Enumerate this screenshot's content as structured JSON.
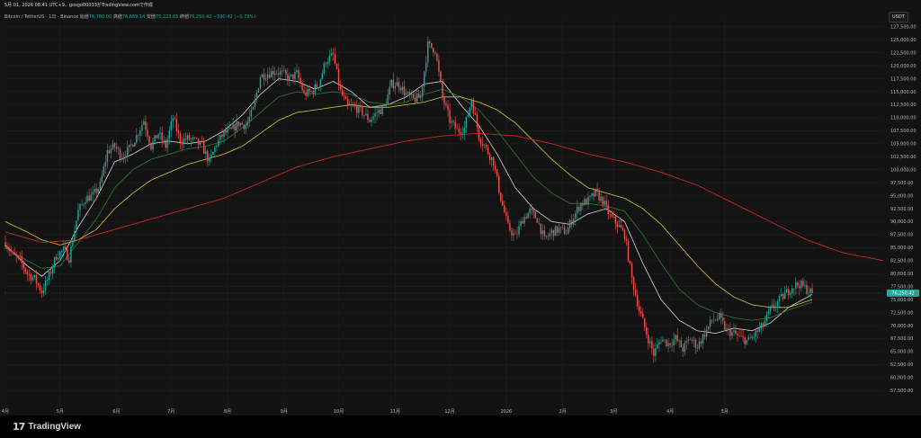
{
  "header": {
    "text": "5月 01, 2026 08:41 UTC+9、gosgo00033がTradingView.comで作成"
  },
  "legend": {
    "symbol": "Bitcoin / TetherUS · 1日 · Binance",
    "open_label": "始値",
    "open": "76,780.00",
    "high_label": "高値",
    "high": "76,669.14",
    "low_label": "安値",
    "low": "75,223.65",
    "close_label": "終値",
    "close": "76,250.42",
    "change": "−590.42 (−0.73%)"
  },
  "currency": "USDT",
  "brand": "TradingView",
  "colors": {
    "background": "#131313",
    "up": "#26a69a",
    "down": "#ef5350",
    "ema_white": "#d7d7d7",
    "ema_green": "#2e7d32",
    "ema_yellow": "#d4c93c",
    "ema_red": "#c62828"
  },
  "chart_data": {
    "type": "candlestick",
    "ylim": [
      56500,
      128500
    ],
    "y_ticks": [
      "127,500.00",
      "125,000.00",
      "122,500.00",
      "120,000.00",
      "117,500.00",
      "115,000.00",
      "112,500.00",
      "110,000.00",
      "107,500.00",
      "105,000.00",
      "102,500.00",
      "100,000.00",
      "97,500.00",
      "95,000.00",
      "92,500.00",
      "90,000.00",
      "87,500.00",
      "85,000.00",
      "82,500.00",
      "80,000.00",
      "77,500.00",
      "75,000.00",
      "72,500.00",
      "70,000.00",
      "67,500.00",
      "65,000.00",
      "62,500.00",
      "60,000.00",
      "57,500.00"
    ],
    "x_ticks": [
      "4月",
      "5月",
      "6月",
      "7月",
      "8月",
      "9月",
      "10月",
      "11月",
      "12月",
      "2026",
      "2月",
      "3月",
      "4月",
      "5月"
    ],
    "current_price": 76250.42,
    "current_price_label": "76,250.42",
    "date_start": "2025-04-01",
    "date_end": "2026-05-01",
    "close_path": [
      [
        0,
        86000
      ],
      [
        4,
        83500
      ],
      [
        8,
        82500
      ],
      [
        12,
        80000
      ],
      [
        16,
        79000
      ],
      [
        20,
        76500
      ],
      [
        24,
        79500
      ],
      [
        28,
        83500
      ],
      [
        32,
        84500
      ],
      [
        35,
        83000
      ],
      [
        40,
        92000
      ],
      [
        44,
        94500
      ],
      [
        48,
        95000
      ],
      [
        52,
        97000
      ],
      [
        56,
        103500
      ],
      [
        60,
        104500
      ],
      [
        64,
        102500
      ],
      [
        68,
        104000
      ],
      [
        72,
        106500
      ],
      [
        76,
        109500
      ],
      [
        80,
        104500
      ],
      [
        84,
        107000
      ],
      [
        88,
        104500
      ],
      [
        92,
        110000
      ],
      [
        96,
        105500
      ],
      [
        100,
        106000
      ],
      [
        104,
        105500
      ],
      [
        108,
        104500
      ],
      [
        112,
        101500
      ],
      [
        116,
        105000
      ],
      [
        120,
        107000
      ],
      [
        124,
        107500
      ],
      [
        128,
        109000
      ],
      [
        132,
        108500
      ],
      [
        136,
        111500
      ],
      [
        140,
        118000
      ],
      [
        144,
        118500
      ],
      [
        148,
        119000
      ],
      [
        152,
        118500
      ],
      [
        156,
        117500
      ],
      [
        160,
        118500
      ],
      [
        164,
        114500
      ],
      [
        168,
        115000
      ],
      [
        172,
        116500
      ],
      [
        176,
        121000
      ],
      [
        180,
        122000
      ],
      [
        184,
        115000
      ],
      [
        188,
        112000
      ],
      [
        192,
        112000
      ],
      [
        196,
        111000
      ],
      [
        200,
        109500
      ],
      [
        204,
        111000
      ],
      [
        208,
        112000
      ],
      [
        212,
        116500
      ],
      [
        216,
        116500
      ],
      [
        220,
        114500
      ],
      [
        224,
        113500
      ],
      [
        228,
        114000
      ],
      [
        232,
        124000
      ],
      [
        236,
        123000
      ],
      [
        240,
        114000
      ],
      [
        244,
        109500
      ],
      [
        248,
        107500
      ],
      [
        252,
        108000
      ],
      [
        256,
        113500
      ],
      [
        260,
        106500
      ],
      [
        264,
        104000
      ],
      [
        268,
        101500
      ],
      [
        272,
        94500
      ],
      [
        276,
        89000
      ],
      [
        280,
        87000
      ],
      [
        284,
        90500
      ],
      [
        288,
        92000
      ],
      [
        292,
        90500
      ],
      [
        296,
        86500
      ],
      [
        300,
        88000
      ],
      [
        304,
        88500
      ],
      [
        308,
        88000
      ],
      [
        312,
        91000
      ],
      [
        316,
        93500
      ],
      [
        320,
        94000
      ],
      [
        324,
        95500
      ],
      [
        328,
        94000
      ],
      [
        332,
        91000
      ],
      [
        336,
        89500
      ],
      [
        340,
        87500
      ],
      [
        344,
        79000
      ],
      [
        348,
        73000
      ],
      [
        352,
        68500
      ],
      [
        356,
        64500
      ],
      [
        360,
        67500
      ],
      [
        364,
        66500
      ],
      [
        368,
        67500
      ],
      [
        372,
        65500
      ],
      [
        376,
        67500
      ],
      [
        380,
        66000
      ],
      [
        384,
        68500
      ],
      [
        388,
        71000
      ],
      [
        392,
        71500
      ],
      [
        396,
        69000
      ],
      [
        400,
        68500
      ],
      [
        404,
        67500
      ],
      [
        408,
        67000
      ],
      [
        412,
        68500
      ],
      [
        416,
        70000
      ],
      [
        420,
        73000
      ],
      [
        424,
        74500
      ],
      [
        428,
        76000
      ],
      [
        432,
        77500
      ],
      [
        436,
        78000
      ],
      [
        440,
        77000
      ],
      [
        443,
        76250
      ]
    ],
    "series": [
      {
        "points": [
          [
            0,
            85500
          ],
          [
            12,
            81500
          ],
          [
            20,
            79500
          ],
          [
            30,
            82500
          ],
          [
            40,
            89000
          ],
          [
            50,
            94500
          ],
          [
            60,
            101500
          ],
          [
            70,
            103000
          ],
          [
            80,
            105000
          ],
          [
            90,
            105500
          ],
          [
            100,
            105000
          ],
          [
            110,
            105500
          ],
          [
            120,
            107500
          ],
          [
            130,
            110500
          ],
          [
            140,
            114500
          ],
          [
            150,
            117500
          ],
          [
            160,
            117000
          ],
          [
            170,
            115500
          ],
          [
            180,
            117000
          ],
          [
            190,
            115000
          ],
          [
            200,
            112000
          ],
          [
            210,
            112500
          ],
          [
            220,
            114000
          ],
          [
            230,
            116500
          ],
          [
            240,
            117000
          ],
          [
            250,
            112500
          ],
          [
            260,
            108500
          ],
          [
            270,
            103000
          ],
          [
            280,
            96500
          ],
          [
            290,
            92500
          ],
          [
            300,
            90000
          ],
          [
            310,
            89500
          ],
          [
            320,
            91500
          ],
          [
            330,
            92500
          ],
          [
            340,
            90000
          ],
          [
            350,
            82000
          ],
          [
            360,
            75000
          ],
          [
            370,
            71000
          ],
          [
            380,
            69000
          ],
          [
            390,
            68500
          ],
          [
            400,
            69500
          ],
          [
            410,
            69000
          ],
          [
            420,
            70500
          ],
          [
            430,
            73500
          ],
          [
            443,
            76000
          ]
        ]
      },
      {
        "points": [
          [
            0,
            85000
          ],
          [
            12,
            82500
          ],
          [
            20,
            81000
          ],
          [
            30,
            81500
          ],
          [
            40,
            86000
          ],
          [
            50,
            90500
          ],
          [
            60,
            96500
          ],
          [
            70,
            100000
          ],
          [
            80,
            102000
          ],
          [
            90,
            103000
          ],
          [
            100,
            104000
          ],
          [
            110,
            104500
          ],
          [
            120,
            105500
          ],
          [
            130,
            108000
          ],
          [
            140,
            111000
          ],
          [
            150,
            114000
          ],
          [
            160,
            115000
          ],
          [
            170,
            114500
          ],
          [
            180,
            115000
          ],
          [
            190,
            114500
          ],
          [
            200,
            113000
          ],
          [
            210,
            112500
          ],
          [
            220,
            113000
          ],
          [
            230,
            114500
          ],
          [
            240,
            115500
          ],
          [
            250,
            114000
          ],
          [
            260,
            111500
          ],
          [
            270,
            107500
          ],
          [
            280,
            103000
          ],
          [
            290,
            98500
          ],
          [
            300,
            95500
          ],
          [
            310,
            93500
          ],
          [
            320,
            93500
          ],
          [
            330,
            93000
          ],
          [
            340,
            92000
          ],
          [
            350,
            87500
          ],
          [
            360,
            82000
          ],
          [
            370,
            77000
          ],
          [
            380,
            74000
          ],
          [
            390,
            72500
          ],
          [
            400,
            71500
          ],
          [
            410,
            71000
          ],
          [
            420,
            71500
          ],
          [
            430,
            73000
          ],
          [
            443,
            74500
          ]
        ]
      },
      {
        "points": [
          [
            0,
            90000
          ],
          [
            12,
            88000
          ],
          [
            20,
            86500
          ],
          [
            30,
            85500
          ],
          [
            40,
            86500
          ],
          [
            50,
            88500
          ],
          [
            60,
            92500
          ],
          [
            70,
            95500
          ],
          [
            80,
            98000
          ],
          [
            90,
            99500
          ],
          [
            100,
            101000
          ],
          [
            110,
            102000
          ],
          [
            120,
            103000
          ],
          [
            130,
            104500
          ],
          [
            140,
            107000
          ],
          [
            150,
            109500
          ],
          [
            160,
            111000
          ],
          [
            170,
            111500
          ],
          [
            180,
            112000
          ],
          [
            190,
            112500
          ],
          [
            200,
            112000
          ],
          [
            210,
            112000
          ],
          [
            220,
            112500
          ],
          [
            230,
            113000
          ],
          [
            240,
            114000
          ],
          [
            250,
            114000
          ],
          [
            260,
            113000
          ],
          [
            270,
            111500
          ],
          [
            280,
            109000
          ],
          [
            290,
            105500
          ],
          [
            300,
            102000
          ],
          [
            310,
            99000
          ],
          [
            320,
            96500
          ],
          [
            330,
            95500
          ],
          [
            340,
            94500
          ],
          [
            350,
            92500
          ],
          [
            360,
            89500
          ],
          [
            370,
            85500
          ],
          [
            380,
            81500
          ],
          [
            390,
            78000
          ],
          [
            400,
            75500
          ],
          [
            410,
            74000
          ],
          [
            420,
            73500
          ],
          [
            430,
            73500
          ],
          [
            443,
            75000
          ]
        ]
      },
      {
        "points": [
          [
            0,
            88000
          ],
          [
            20,
            86000
          ],
          [
            40,
            86500
          ],
          [
            60,
            88500
          ],
          [
            80,
            90500
          ],
          [
            100,
            92500
          ],
          [
            120,
            94500
          ],
          [
            140,
            97500
          ],
          [
            160,
            100500
          ],
          [
            180,
            102500
          ],
          [
            200,
            104000
          ],
          [
            220,
            105500
          ],
          [
            240,
            106500
          ],
          [
            260,
            107000
          ],
          [
            280,
            106500
          ],
          [
            300,
            105000
          ],
          [
            320,
            103000
          ],
          [
            340,
            101500
          ],
          [
            360,
            99500
          ],
          [
            380,
            97000
          ],
          [
            400,
            93500
          ],
          [
            420,
            90000
          ],
          [
            440,
            86500
          ],
          [
            460,
            84000
          ],
          [
            482,
            82500
          ]
        ]
      }
    ]
  }
}
